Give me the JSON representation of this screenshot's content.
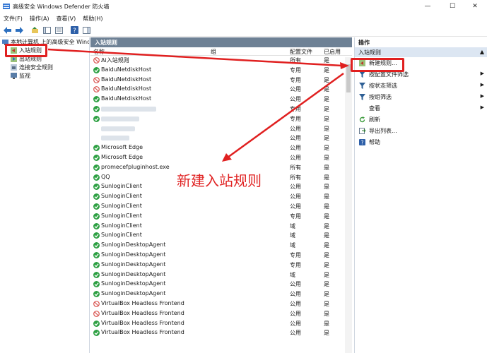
{
  "window": {
    "title": "高级安全 Windows Defender 防火墙",
    "minimize": "—",
    "maximize": "☐",
    "close": "✕"
  },
  "menu": [
    "文件(F)",
    "操作(A)",
    "查看(V)",
    "帮助(H)"
  ],
  "toolbar_icons": [
    "back-icon",
    "forward-icon",
    "up-icon",
    "show-hide-tree-icon",
    "properties-icon",
    "help-icon",
    "show-hide-action-icon"
  ],
  "tree": {
    "root": "本地计算机 上的高级安全 Windows Defender 防火墙",
    "items": [
      "入站规则",
      "出站规则",
      "连接安全规则",
      "监视"
    ]
  },
  "center": {
    "header": "入站规则",
    "columns": {
      "name": "名称",
      "group": "组",
      "profile": "配置文件",
      "enabled": "已启用"
    },
    "rules": [
      {
        "name": "Ai入站规则",
        "profile": "所有",
        "enabled": "是",
        "status": "block"
      },
      {
        "name": "BaiduNetdiskHost",
        "profile": "专用",
        "enabled": "是",
        "status": "allow"
      },
      {
        "name": "BaiduNetdiskHost",
        "profile": "专用",
        "enabled": "是",
        "status": "block"
      },
      {
        "name": "BaiduNetdiskHost",
        "profile": "公用",
        "enabled": "是",
        "status": "block"
      },
      {
        "name": "BaiduNetdiskHost",
        "profile": "公用",
        "enabled": "是",
        "status": "allow"
      },
      {
        "name": "",
        "profile": "专用",
        "enabled": "是",
        "status": "allow",
        "redacted": 78
      },
      {
        "name": "",
        "profile": "专用",
        "enabled": "是",
        "status": "allow",
        "redacted": 54
      },
      {
        "name": "",
        "profile": "公用",
        "enabled": "是",
        "status": "none",
        "redacted": 48
      },
      {
        "name": "",
        "profile": "公用",
        "enabled": "是",
        "status": "none",
        "redacted": 40
      },
      {
        "name": "Microsoft Edge",
        "profile": "公用",
        "enabled": "是",
        "status": "allow"
      },
      {
        "name": "Microsoft Edge",
        "profile": "公用",
        "enabled": "是",
        "status": "allow"
      },
      {
        "name": "promecefpluginhost.exe",
        "profile": "所有",
        "enabled": "是",
        "status": "allow"
      },
      {
        "name": "QQ",
        "profile": "所有",
        "enabled": "是",
        "status": "allow"
      },
      {
        "name": "SunloginClient",
        "profile": "公用",
        "enabled": "是",
        "status": "allow"
      },
      {
        "name": "SunloginClient",
        "profile": "公用",
        "enabled": "是",
        "status": "allow"
      },
      {
        "name": "SunloginClient",
        "profile": "公用",
        "enabled": "是",
        "status": "allow"
      },
      {
        "name": "SunloginClient",
        "profile": "专用",
        "enabled": "是",
        "status": "allow"
      },
      {
        "name": "SunloginClient",
        "profile": "域",
        "enabled": "是",
        "status": "allow"
      },
      {
        "name": "SunloginClient",
        "profile": "域",
        "enabled": "是",
        "status": "allow"
      },
      {
        "name": "SunloginDesktopAgent",
        "profile": "域",
        "enabled": "是",
        "status": "allow"
      },
      {
        "name": "SunloginDesktopAgent",
        "profile": "专用",
        "enabled": "是",
        "status": "allow"
      },
      {
        "name": "SunloginDesktopAgent",
        "profile": "专用",
        "enabled": "是",
        "status": "allow"
      },
      {
        "name": "SunloginDesktopAgent",
        "profile": "域",
        "enabled": "是",
        "status": "allow"
      },
      {
        "name": "SunloginDesktopAgent",
        "profile": "公用",
        "enabled": "是",
        "status": "allow"
      },
      {
        "name": "SunloginDesktopAgent",
        "profile": "公用",
        "enabled": "是",
        "status": "allow"
      },
      {
        "name": "VirtualBox Headless Frontend",
        "profile": "公用",
        "enabled": "是",
        "status": "block"
      },
      {
        "name": "VirtualBox Headless Frontend",
        "profile": "公用",
        "enabled": "是",
        "status": "block"
      },
      {
        "name": "VirtualBox Headless Frontend",
        "profile": "公用",
        "enabled": "是",
        "status": "allow"
      },
      {
        "name": "VirtualBox Headless Frontend",
        "profile": "公用",
        "enabled": "是",
        "status": "allow"
      }
    ]
  },
  "actions": {
    "header": "操作",
    "section": "入站规则",
    "items": [
      {
        "label": "新建规则...",
        "icon": "new-rule-icon",
        "submenu": false
      },
      {
        "label": "按配置文件筛选",
        "icon": "filter-icon",
        "submenu": true
      },
      {
        "label": "按状态筛选",
        "icon": "filter-icon",
        "submenu": true
      },
      {
        "label": "按组筛选",
        "icon": "filter-icon",
        "submenu": true
      },
      {
        "label": "查看",
        "icon": "",
        "submenu": true
      },
      {
        "label": "刷新",
        "icon": "refresh-icon",
        "submenu": false
      },
      {
        "label": "导出列表...",
        "icon": "export-icon",
        "submenu": false
      },
      {
        "label": "帮助",
        "icon": "help-icon",
        "submenu": false
      }
    ]
  },
  "annotation": {
    "text": "新建入站规则",
    "color": "#e02424"
  },
  "colors": {
    "allow": "#2ea043",
    "block": "#d9534f",
    "pane_header": "#6e8195",
    "highlight": "#dce6f2",
    "annotation": "#e02020"
  }
}
